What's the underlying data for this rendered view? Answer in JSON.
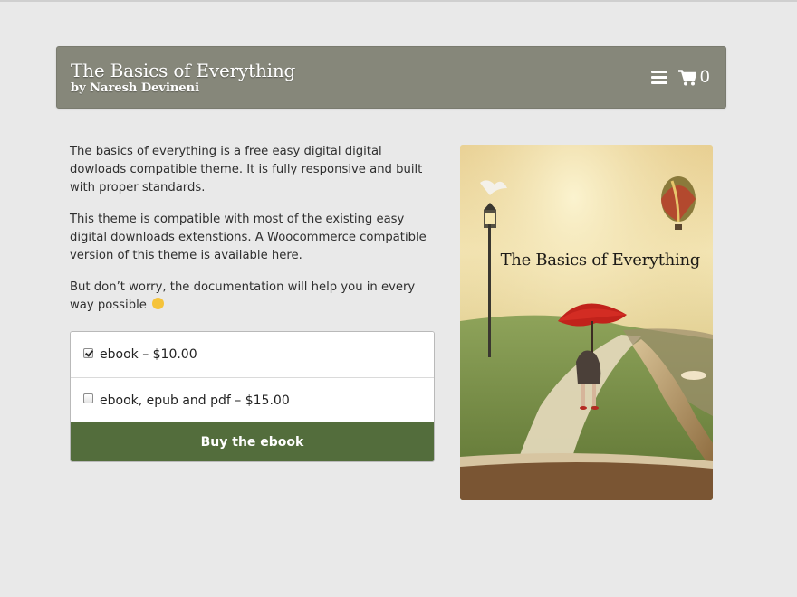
{
  "header": {
    "title": "The Basics of Everything",
    "author": "by Naresh Devineni",
    "cart_count": "0"
  },
  "content": {
    "paragraphs": [
      "The basics of everything is a free easy digital digital dowloads compatible theme. It is fully responsive and built with proper standards.",
      "This theme is compatible with most of the existing easy digital downloads extenstions. A Woocommerce compatible version of this theme is available here.",
      "But don’t worry, the documentation will help you in every way possible"
    ]
  },
  "purchase": {
    "options": [
      {
        "label": "ebook – $10.00",
        "checked": true
      },
      {
        "label": "ebook, epub and pdf – $15.00",
        "checked": false
      }
    ],
    "button_label": "Buy the ebook"
  },
  "cover": {
    "title": "The Basics of Everything"
  },
  "icons": {
    "menu": "hamburger-menu-icon",
    "cart": "shopping-cart-icon",
    "smiley": "smiley-emoji-icon"
  },
  "colors": {
    "header_bg": "#86877a",
    "button_bg": "#536d3c",
    "page_bg": "#e9e9e9"
  }
}
